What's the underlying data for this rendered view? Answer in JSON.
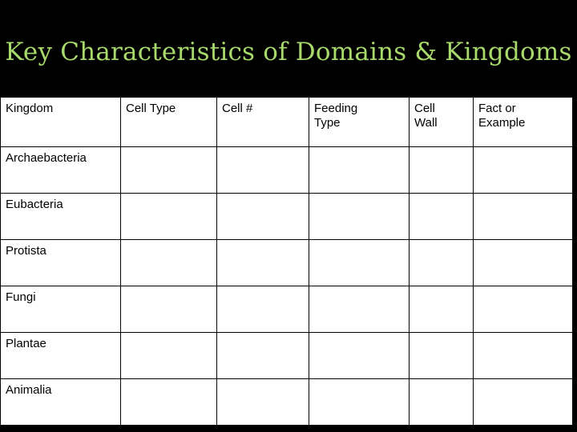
{
  "slide": {
    "background_color": "#000000",
    "title": "Key Characteristics of Domains & Kingdoms",
    "title_color": "#a8d96b"
  },
  "table": {
    "border_color": "#000000",
    "cell_background": "#ffffff",
    "text_color": "#000000",
    "headers": [
      {
        "line1": "Kingdom",
        "line2": ""
      },
      {
        "line1": "Cell Type",
        "line2": ""
      },
      {
        "line1": "Cell #",
        "line2": ""
      },
      {
        "line1": "Feeding",
        "line2": "Type"
      },
      {
        "line1": "Cell",
        "line2": "Wall"
      },
      {
        "line1": "Fact or",
        "line2": "Example"
      }
    ],
    "rows": [
      {
        "kingdom": "Archaebacteria",
        "cell_type": "",
        "cell_number": "",
        "feeding_type": "",
        "cell_wall": "",
        "fact_or_example": ""
      },
      {
        "kingdom": "Eubacteria",
        "cell_type": "",
        "cell_number": "",
        "feeding_type": "",
        "cell_wall": "",
        "fact_or_example": ""
      },
      {
        "kingdom": "Protista",
        "cell_type": "",
        "cell_number": "",
        "feeding_type": "",
        "cell_wall": "",
        "fact_or_example": ""
      },
      {
        "kingdom": "Fungi",
        "cell_type": "",
        "cell_number": "",
        "feeding_type": "",
        "cell_wall": "",
        "fact_or_example": ""
      },
      {
        "kingdom": "Plantae",
        "cell_type": "",
        "cell_number": "",
        "feeding_type": "",
        "cell_wall": "",
        "fact_or_example": ""
      },
      {
        "kingdom": "Animalia",
        "cell_type": "",
        "cell_number": "",
        "feeding_type": "",
        "cell_wall": "",
        "fact_or_example": ""
      }
    ]
  }
}
